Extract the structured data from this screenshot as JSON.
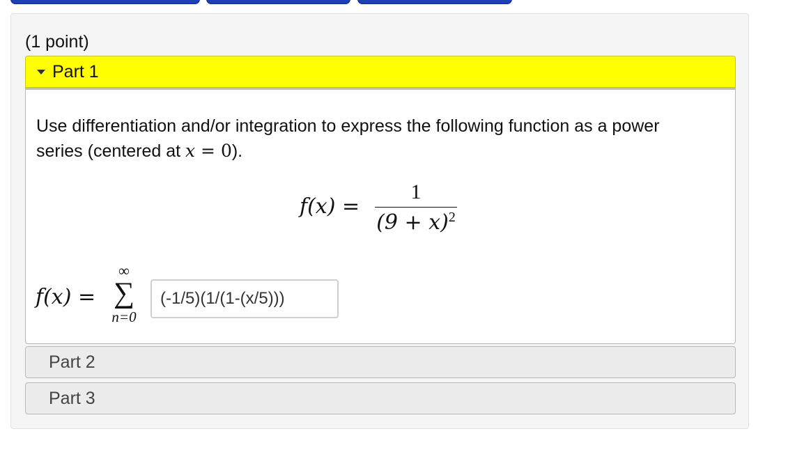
{
  "problem": {
    "points": "(1 point)",
    "parts": [
      {
        "label": "Part 1"
      },
      {
        "label": "Part 2"
      },
      {
        "label": "Part 3"
      }
    ]
  },
  "part1": {
    "instructions_text": "Use differentiation and/or integration to express the following function as a power series (centered at ",
    "instructions_var": "x",
    "instructions_eq": " = 0",
    "instructions_end": ").",
    "function_lhs": "f(x) =",
    "numerator": "1",
    "denominator_base": "(9 + x)",
    "denominator_exp": "2",
    "answer_lhs": "f(x) =",
    "sum_upper": "∞",
    "sum_symbol": "∑",
    "sum_lower": "n=0",
    "answer_value": "(-1/5)(1/(1-(x/5)))"
  },
  "colors": {
    "active_header": "#ffff00",
    "collapsed_header": "#ececec",
    "top_tab": "#1f3fb5"
  }
}
